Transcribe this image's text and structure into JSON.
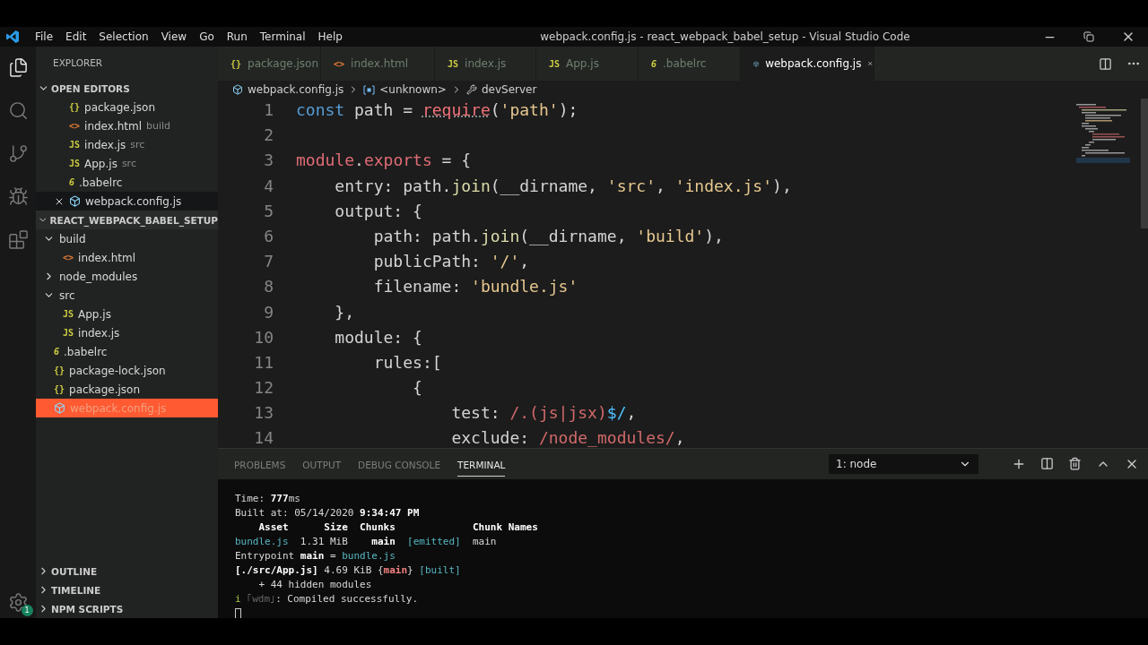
{
  "window": {
    "title": "webpack.config.js - react_webpack_babel_setup - Visual Studio Code"
  },
  "menu": [
    "File",
    "Edit",
    "Selection",
    "View",
    "Go",
    "Run",
    "Terminal",
    "Help"
  ],
  "activity_bar": {
    "settings_badge": "1"
  },
  "sidebar": {
    "title": "EXPLORER",
    "open_editors": {
      "title": "OPEN EDITORS",
      "expanded": true,
      "items": [
        {
          "icon": "{}",
          "kind": "json",
          "name": "package.json",
          "selected": false
        },
        {
          "icon": "<>",
          "kind": "html",
          "name": "index.html",
          "hint": "build",
          "selected": false
        },
        {
          "icon": "JS",
          "kind": "js",
          "name": "index.js",
          "hint": "src",
          "selected": false
        },
        {
          "icon": "JS",
          "kind": "js",
          "name": "App.js",
          "hint": "src",
          "selected": false
        },
        {
          "icon": "6",
          "kind": "babel",
          "name": ".babelrc",
          "selected": false
        },
        {
          "kind": "webpack",
          "name": "webpack.config.js",
          "selected": true
        }
      ]
    },
    "project": {
      "title": "REACT_WEBPACK_BABEL_SETUP",
      "expanded": true,
      "items": [
        {
          "kind": "folder",
          "name": "build",
          "expanded": true,
          "selected": false,
          "children": [
            {
              "icon": "<>",
              "kind": "html",
              "name": "index.html",
              "selected": false
            }
          ]
        },
        {
          "kind": "folder",
          "name": "node_modules",
          "expanded": false,
          "selected": false
        },
        {
          "kind": "folder",
          "name": "src",
          "expanded": true,
          "selected": false,
          "children": [
            {
              "icon": "JS",
              "kind": "js",
              "name": "App.js",
              "selected": false
            },
            {
              "icon": "JS",
              "kind": "js",
              "name": "index.js",
              "selected": false
            }
          ]
        },
        {
          "icon": "6",
          "kind": "babel",
          "name": ".babelrc",
          "selected": false
        },
        {
          "icon": "{}",
          "kind": "json",
          "name": "package-lock.json",
          "selected": false
        },
        {
          "icon": "{}",
          "kind": "json",
          "name": "package.json",
          "selected": false
        },
        {
          "kind": "webpack",
          "name": "webpack.config.js",
          "selected": true
        }
      ]
    },
    "sections": [
      {
        "title": "OUTLINE",
        "expanded": false
      },
      {
        "title": "TIMELINE",
        "expanded": false
      },
      {
        "title": "NPM SCRIPTS",
        "expanded": false
      }
    ]
  },
  "tabs": [
    {
      "icon": "{}",
      "kind": "json",
      "label": "package.json",
      "selected": false
    },
    {
      "icon": "<>",
      "kind": "html",
      "label": "index.html",
      "selected": false
    },
    {
      "icon": "JS",
      "kind": "js",
      "label": "index.js",
      "selected": false
    },
    {
      "icon": "JS",
      "kind": "js",
      "label": "App.js",
      "selected": false
    },
    {
      "icon": "6",
      "kind": "babel",
      "label": ".babelrc",
      "selected": false
    },
    {
      "kind": "webpack",
      "label": "webpack.config.js",
      "selected": true
    }
  ],
  "breadcrumbs": [
    {
      "kind": "webpack",
      "label": "webpack.config.js"
    },
    {
      "kind": "symbol",
      "label": "<unknown>"
    },
    {
      "kind": "wrench",
      "label": "devServer"
    }
  ],
  "code": [
    {
      "number": "1",
      "tokens": [
        {
          "kind": "keyword",
          "text": "const"
        },
        {
          "kind": "plain",
          "text": " path = "
        },
        {
          "kind": "call",
          "text": "require"
        },
        {
          "kind": "plain",
          "text": "("
        },
        {
          "kind": "string",
          "text": "'path'"
        },
        {
          "kind": "plain",
          "text": ");"
        }
      ]
    },
    {
      "number": "2"
    },
    {
      "number": "3",
      "tokens": [
        {
          "kind": "object",
          "text": "module"
        },
        {
          "kind": "plain",
          "text": "."
        },
        {
          "kind": "object",
          "text": "exports"
        },
        {
          "kind": "plain",
          "text": " = {"
        }
      ]
    },
    {
      "number": "4",
      "tokens": [
        {
          "kind": "plain",
          "text": "    entry: path."
        },
        {
          "kind": "function",
          "text": "join"
        },
        {
          "kind": "plain",
          "text": "(__dirname, "
        },
        {
          "kind": "string",
          "text": "'src'"
        },
        {
          "kind": "plain",
          "text": ", "
        },
        {
          "kind": "string",
          "text": "'index.js'"
        },
        {
          "kind": "plain",
          "text": "),"
        }
      ]
    },
    {
      "number": "5",
      "tokens": [
        {
          "kind": "plain",
          "text": "    output: {"
        }
      ]
    },
    {
      "number": "6",
      "tokens": [
        {
          "kind": "plain",
          "text": "        path: path."
        },
        {
          "kind": "function",
          "text": "join"
        },
        {
          "kind": "plain",
          "text": "(__dirname, "
        },
        {
          "kind": "string",
          "text": "'build'"
        },
        {
          "kind": "plain",
          "text": "),"
        }
      ]
    },
    {
      "number": "7",
      "tokens": [
        {
          "kind": "plain",
          "text": "        publicPath: "
        },
        {
          "kind": "string",
          "text": "'/'"
        },
        {
          "kind": "plain",
          "text": ","
        }
      ]
    },
    {
      "number": "8",
      "tokens": [
        {
          "kind": "plain",
          "text": "        filename: "
        },
        {
          "kind": "string",
          "text": "'bundle.js'"
        }
      ]
    },
    {
      "number": "9",
      "tokens": [
        {
          "kind": "plain",
          "text": "    },"
        }
      ]
    },
    {
      "number": "10",
      "tokens": [
        {
          "kind": "plain",
          "text": "    module: {"
        }
      ]
    },
    {
      "number": "11",
      "tokens": [
        {
          "kind": "plain",
          "text": "        rules:["
        }
      ]
    },
    {
      "number": "12",
      "tokens": [
        {
          "kind": "plain",
          "text": "            {"
        }
      ]
    },
    {
      "number": "13",
      "tokens": [
        {
          "kind": "plain",
          "text": "                test: "
        },
        {
          "kind": "regex",
          "text": "/.(js|jsx)"
        },
        {
          "kind": "regex_end",
          "text": "$/"
        },
        {
          "kind": "plain",
          "text": ","
        }
      ]
    },
    {
      "number": "14",
      "tokens": [
        {
          "kind": "plain",
          "text": "                exclude: "
        },
        {
          "kind": "regex",
          "text": "/node_modules/"
        },
        {
          "kind": "plain",
          "text": ","
        }
      ]
    }
  ],
  "panel": {
    "tabs": [
      {
        "label": "PROBLEMS",
        "selected": false
      },
      {
        "label": "OUTPUT",
        "selected": false
      },
      {
        "label": "DEBUG CONSOLE",
        "selected": false
      },
      {
        "label": "TERMINAL",
        "selected": true
      }
    ],
    "terminal_select": "1: node",
    "lines": [
      [
        {
          "kind": "plain",
          "text": "Time: "
        },
        {
          "kind": "bold",
          "text": "777"
        },
        {
          "kind": "plain",
          "text": "ms"
        }
      ],
      [
        {
          "kind": "plain",
          "text": "Built at: 05/14/2020 "
        },
        {
          "kind": "bold",
          "text": "9:34:47 PM"
        }
      ],
      [
        {
          "kind": "bold",
          "text": "    Asset      Size  Chunks             Chunk Names"
        }
      ],
      [
        {
          "kind": "cyan",
          "text": "bundle.js"
        },
        {
          "kind": "plain",
          "text": "  1.31 MiB    "
        },
        {
          "kind": "bold",
          "text": "main"
        },
        {
          "kind": "cyan",
          "text": "  [emitted]"
        },
        {
          "kind": "plain",
          "text": "  main"
        }
      ],
      [
        {
          "kind": "plain",
          "text": "Entrypoint "
        },
        {
          "kind": "bold",
          "text": "main"
        },
        {
          "kind": "plain",
          "text": " = "
        },
        {
          "kind": "cyan",
          "text": "bundle.js"
        }
      ],
      [
        {
          "kind": "bold",
          "text": "[./src/App.js]"
        },
        {
          "kind": "plain",
          "text": " 4.69 KiB {"
        },
        {
          "kind": "red",
          "text": "main"
        },
        {
          "kind": "plain",
          "text": "} "
        },
        {
          "kind": "cyan",
          "text": "[built]"
        }
      ],
      [
        {
          "kind": "plain",
          "text": "    + 44 hidden modules"
        }
      ],
      [
        {
          "kind": "green",
          "text": "i "
        },
        {
          "kind": "dim",
          "text": "｢wdm｣"
        },
        {
          "kind": "plain",
          "text": ": Compiled successfully."
        }
      ]
    ]
  }
}
